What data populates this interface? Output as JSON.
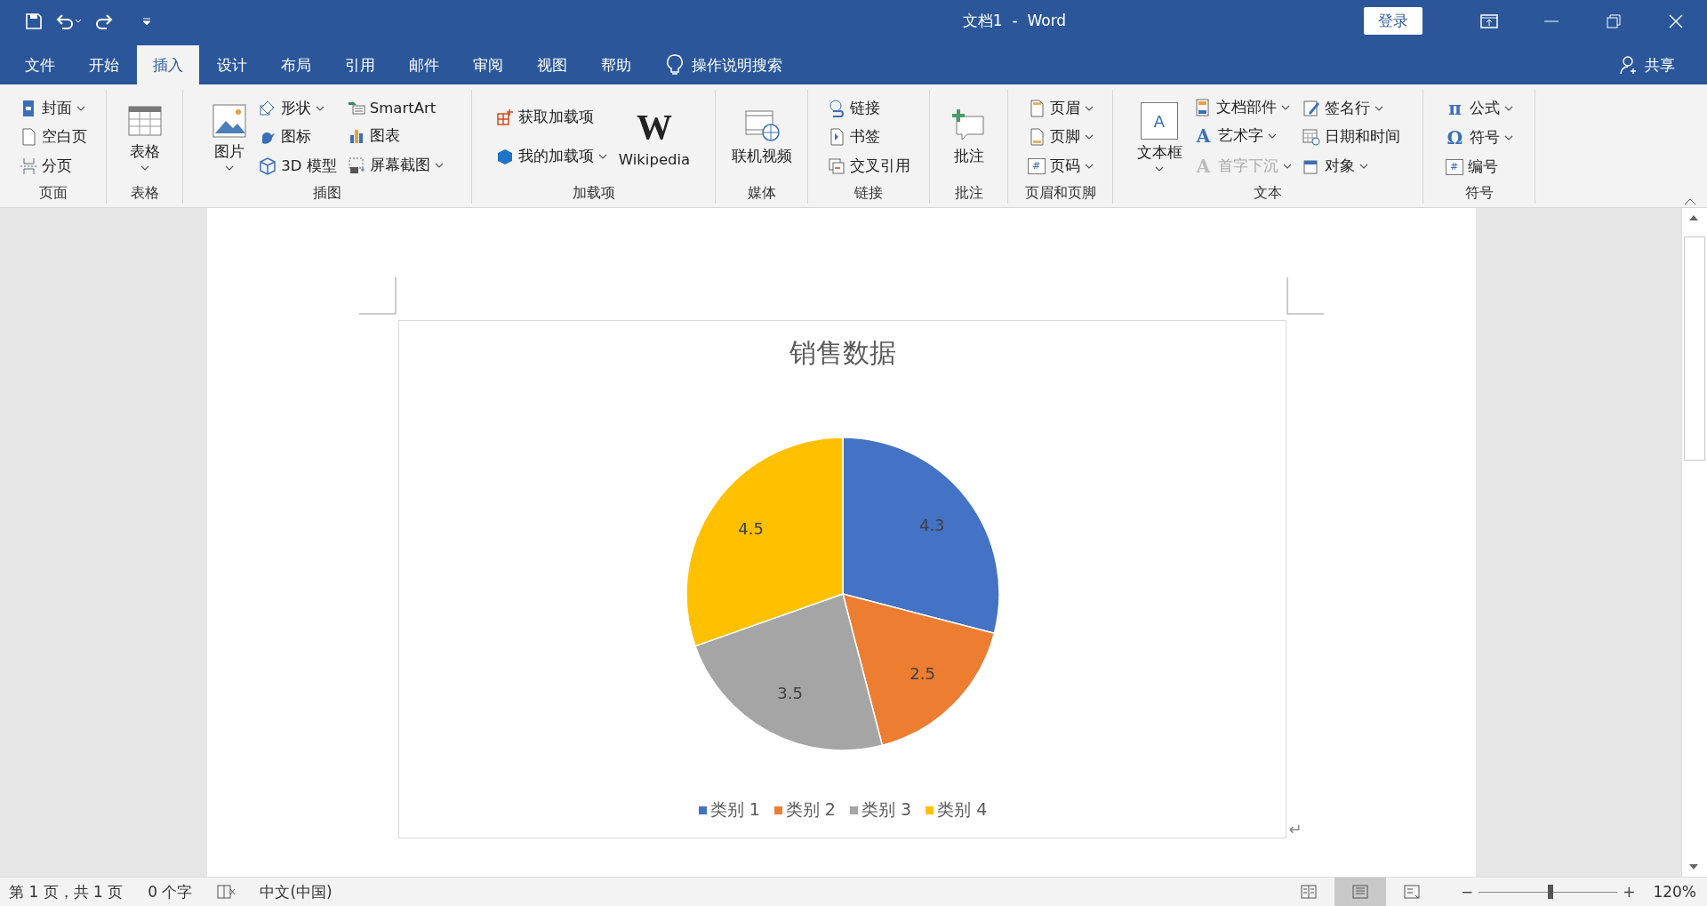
{
  "title_bar": {
    "title": "文档1  -  Word",
    "login": "登录"
  },
  "menu_tabs": [
    {
      "label": "文件",
      "selected": false
    },
    {
      "label": "开始",
      "selected": false
    },
    {
      "label": "插入",
      "selected": true
    },
    {
      "label": "设计",
      "selected": false
    },
    {
      "label": "布局",
      "selected": false
    },
    {
      "label": "引用",
      "selected": false
    },
    {
      "label": "邮件",
      "selected": false
    },
    {
      "label": "审阅",
      "selected": false
    },
    {
      "label": "视图",
      "selected": false
    },
    {
      "label": "帮助",
      "selected": false
    }
  ],
  "tell_me": "操作说明搜索",
  "share": "共享",
  "ribbon_groups": [
    {
      "label": "页面",
      "columns": [
        [
          {
            "kind": "small",
            "label": "封面",
            "dropdown": true
          },
          {
            "kind": "small",
            "label": "空白页",
            "dropdown": false
          },
          {
            "kind": "small",
            "label": "分页",
            "dropdown": false
          }
        ]
      ]
    },
    {
      "label": "表格",
      "columns": [
        [
          {
            "kind": "large",
            "label": "表格",
            "dropdown": true
          }
        ]
      ]
    },
    {
      "label": "插图",
      "columns": [
        [
          {
            "kind": "large",
            "label": "图片",
            "dropdown": true
          }
        ],
        [
          {
            "kind": "small",
            "label": "形状",
            "dropdown": true
          },
          {
            "kind": "small",
            "label": "图标",
            "dropdown": false
          },
          {
            "kind": "small",
            "label": "3D 模型",
            "dropdown": false
          }
        ],
        [
          {
            "kind": "small",
            "label": "SmartArt",
            "dropdown": false
          },
          {
            "kind": "small",
            "label": "图表",
            "dropdown": false
          },
          {
            "kind": "small",
            "label": "屏幕截图",
            "dropdown": true
          }
        ]
      ]
    },
    {
      "label": "加载项",
      "columns": [
        [
          {
            "kind": "small",
            "label": "获取加载项",
            "dropdown": false
          },
          {
            "kind": "small",
            "label": "我的加载项",
            "dropdown": true
          }
        ],
        [
          {
            "kind": "large",
            "label": "Wikipedia",
            "dropdown": false,
            "glyph": "W"
          }
        ]
      ]
    },
    {
      "label": "媒体",
      "columns": [
        [
          {
            "kind": "large",
            "label": "联机视频",
            "dropdown": false
          }
        ]
      ]
    },
    {
      "label": "链接",
      "columns": [
        [
          {
            "kind": "small",
            "label": "链接",
            "dropdown": false
          },
          {
            "kind": "small",
            "label": "书签",
            "dropdown": false
          },
          {
            "kind": "small",
            "label": "交叉引用",
            "dropdown": false
          }
        ]
      ]
    },
    {
      "label": "批注",
      "columns": [
        [
          {
            "kind": "large",
            "label": "批注",
            "dropdown": false
          }
        ]
      ]
    },
    {
      "label": "页眉和页脚",
      "columns": [
        [
          {
            "kind": "small",
            "label": "页眉",
            "dropdown": true
          },
          {
            "kind": "small",
            "label": "页脚",
            "dropdown": true
          },
          {
            "kind": "small",
            "label": "页码",
            "dropdown": true,
            "glyph": "#"
          }
        ]
      ]
    },
    {
      "label": "文本",
      "columns": [
        [
          {
            "kind": "large",
            "label": "文本框",
            "dropdown": true,
            "glyph": "A"
          }
        ],
        [
          {
            "kind": "small",
            "label": "文档部件",
            "dropdown": true
          },
          {
            "kind": "small",
            "label": "艺术字",
            "dropdown": true,
            "glyph": "A"
          },
          {
            "kind": "small",
            "label": "首字下沉",
            "dropdown": true,
            "disabled": true,
            "glyph": "A"
          }
        ],
        [
          {
            "kind": "small",
            "label": "签名行",
            "dropdown": true
          },
          {
            "kind": "small",
            "label": "日期和时间",
            "dropdown": false
          },
          {
            "kind": "small",
            "label": "对象",
            "dropdown": true
          }
        ]
      ]
    },
    {
      "label": "符号",
      "columns": [
        [
          {
            "kind": "small",
            "label": "公式",
            "dropdown": true,
            "glyph": "π"
          },
          {
            "kind": "small",
            "label": "符号",
            "dropdown": true,
            "glyph": "Ω"
          },
          {
            "kind": "small",
            "label": "编号",
            "dropdown": false,
            "glyph": "#"
          }
        ]
      ]
    }
  ],
  "chart": {
    "chart_data": {
      "type": "pie",
      "title": "销售数据",
      "categories": [
        "类别 1",
        "类别 2",
        "类别 3",
        "类别 4"
      ],
      "series": [
        {
          "values": [
            4.3,
            2.5,
            3.5,
            4.5
          ],
          "colors": [
            "#4472c4",
            "#ed7d31",
            "#a5a5a5",
            "#ffc000"
          ]
        }
      ],
      "data_labels": true
    },
    "labels": [
      "4.3",
      "2.5",
      "3.5",
      "4.5"
    ]
  },
  "paragraph_mark": "↵",
  "status_bar": {
    "page": "第 1 页，共 1 页",
    "words": "0 个字",
    "language": "中文(中国)",
    "views": [
      {
        "selected": false
      },
      {
        "selected": true
      },
      {
        "selected": false
      }
    ],
    "zoom_minus": "−",
    "zoom_plus": "+",
    "zoom": {
      "level": 0.52
    },
    "zoom_text": "120%"
  }
}
